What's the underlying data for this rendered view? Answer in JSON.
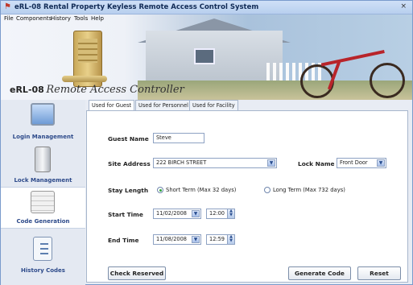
{
  "window": {
    "title": "eRL-08 Rental Property Keyless Remote Access Control System",
    "close_glyph": "×"
  },
  "menu": [
    "File",
    "Components",
    "History",
    "Tools",
    "Help"
  ],
  "brand": {
    "model": "eRL-08",
    "script": "Remote Access Controller"
  },
  "sidebar": {
    "items": [
      {
        "label": "Login Management",
        "icon": "computer-icon"
      },
      {
        "label": "Lock Management",
        "icon": "keypad-lock-icon"
      },
      {
        "label": "Code Generation",
        "icon": "code-generation-icon",
        "selected": true
      },
      {
        "label": "History Codes",
        "icon": "history-list-icon"
      }
    ]
  },
  "tabs": [
    {
      "label": "Used for Guest",
      "active": true
    },
    {
      "label": "Used for Personnel"
    },
    {
      "label": "Used for Facility"
    }
  ],
  "form": {
    "guest_name_label": "Guest Name",
    "guest_name": "Steve",
    "site_address_label": "Site Address",
    "site_address": "222 BIRCH STREET",
    "lock_name_label": "Lock Name",
    "lock_name": "Front Door",
    "stay_length_label": "Stay Length",
    "short_term": "Short Term (Max 32 days)",
    "long_term": "Long Term (Max 732 days)",
    "start_time_label": "Start Time",
    "start_date": "11/02/2008",
    "start_time": "12:00",
    "end_time_label": "End Time",
    "end_date": "11/08/2008",
    "end_time": "12:59"
  },
  "buttons": {
    "check_reserved": "Check Reserved",
    "generate_code": "Generate Code",
    "reset": "Reset"
  },
  "icons": {
    "dropdown_glyph": "▼",
    "spin_up": "▲",
    "spin_down": "▼",
    "app_glyph": "⚑"
  }
}
